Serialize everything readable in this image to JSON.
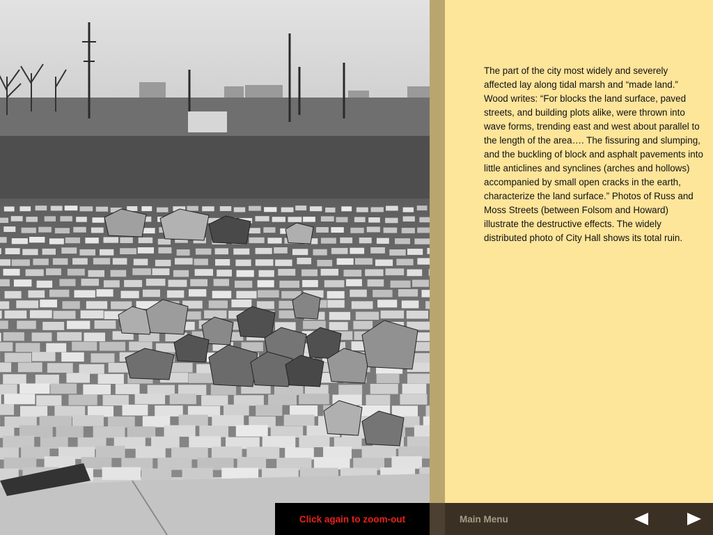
{
  "photo": {
    "subject": "Cobblestone street buckled by earthquake amid ruins"
  },
  "caption": {
    "text": "The part of the city most widely and severely affected lay along tidal marsh and “made land.” Wood writes: “For blocks the land surface, paved streets, and building plots alike, were thrown into wave forms, trending east and west about parallel to the length of the area…. The fissuring and slumping, and the buckling of block and asphalt pavements into little anticlines and synclines (arches and hollows) accompanied by small open cracks in the earth, characterize the land surface.” Photos of Russ and Moss Streets (between Folsom and Howard) illustrate the destructive effects. The widely distributed photo of City Hall shows its total ruin."
  },
  "zoom": {
    "label": "Click again to zoom-out"
  },
  "bottom_bar": {
    "main_menu_label": "Main Menu",
    "prev_icon": "triangle-left-icon",
    "next_icon": "triangle-right-icon"
  },
  "colors": {
    "text_panel_bg": "#fde59a",
    "divider": "#b9a66e",
    "bottom_bar_bg": "#3a3024",
    "zoom_label": "#e8201c",
    "menu_label": "#a79c88",
    "nav_arrow": "#ffffff"
  }
}
